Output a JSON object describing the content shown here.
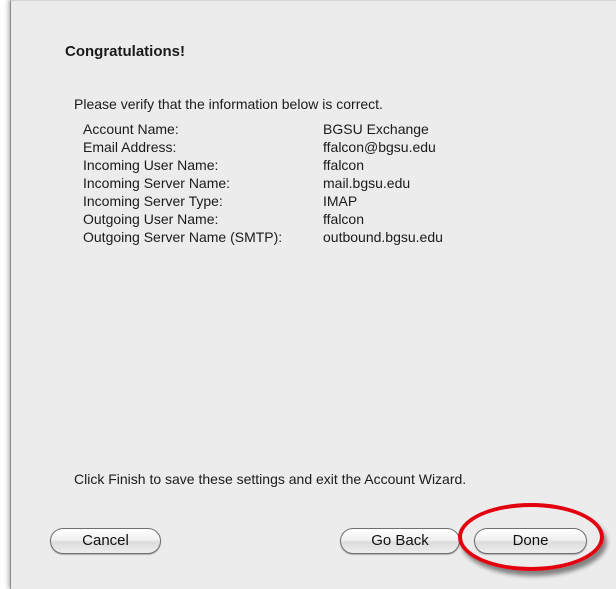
{
  "heading": "Congratulations!",
  "intro": "Please verify that the information below is correct.",
  "fields": [
    {
      "label": "Account Name:",
      "value": "BGSU Exchange"
    },
    {
      "label": "Email Address:",
      "value": "ffalcon@bgsu.edu"
    },
    {
      "label": "Incoming User Name:",
      "value": "ffalcon"
    },
    {
      "label": "Incoming Server Name:",
      "value": "mail.bgsu.edu"
    },
    {
      "label": "Incoming Server Type:",
      "value": "IMAP"
    },
    {
      "label": "Outgoing User Name:",
      "value": "ffalcon"
    },
    {
      "label": "Outgoing Server Name (SMTP):",
      "value": "outbound.bgsu.edu"
    }
  ],
  "finish_note": "Click Finish to save these settings and exit the Account Wizard.",
  "buttons": {
    "cancel": "Cancel",
    "go_back": "Go Back",
    "done": "Done"
  },
  "colors": {
    "panel_background": "#ececec",
    "highlight_ring": "#e3000f"
  }
}
